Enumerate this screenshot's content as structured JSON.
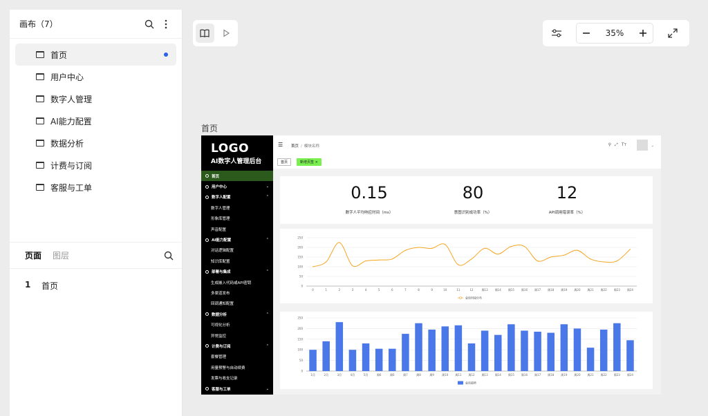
{
  "left_panel": {
    "title": "画布（7）",
    "canvases": [
      {
        "label": "首页",
        "active": true
      },
      {
        "label": "用户中心"
      },
      {
        "label": "数字人管理"
      },
      {
        "label": "AI能力配置"
      },
      {
        "label": "数据分析"
      },
      {
        "label": "计费与订阅"
      },
      {
        "label": "客服与工单"
      }
    ],
    "tabs": {
      "pages": "页面",
      "layers": "图层"
    },
    "pages": [
      {
        "num": "1",
        "label": "首页"
      }
    ]
  },
  "toolbar": {
    "zoom": "35%"
  },
  "canvas_label": "首页",
  "artboard": {
    "logo": "LOGO",
    "subtitle": "AI数字人管理后台",
    "nav": [
      {
        "label": "首页",
        "kind": "grp",
        "active": true
      },
      {
        "label": "用户中心",
        "kind": "grp",
        "chev": "⌄"
      },
      {
        "label": "数字人配置",
        "kind": "grp",
        "chev": "⌃"
      },
      {
        "label": "数字人管理",
        "kind": "sub"
      },
      {
        "label": "形象库管理",
        "kind": "sub"
      },
      {
        "label": "声音配置",
        "kind": "sub"
      },
      {
        "label": "AI能力配置",
        "kind": "grp",
        "chev": "⌃"
      },
      {
        "label": "对话逻辑配置",
        "kind": "sub"
      },
      {
        "label": "知识库配置",
        "kind": "sub"
      },
      {
        "label": "部署与集成",
        "kind": "grp",
        "chev": "⌃"
      },
      {
        "label": "生成嵌入代码或API密钥",
        "kind": "sub"
      },
      {
        "label": "多渠道发布",
        "kind": "sub"
      },
      {
        "label": "回调通知配置",
        "kind": "sub"
      },
      {
        "label": "数据分析",
        "kind": "grp",
        "chev": "⌃"
      },
      {
        "label": "可视化分析",
        "kind": "sub"
      },
      {
        "label": "异常监控",
        "kind": "sub"
      },
      {
        "label": "计费与订阅",
        "kind": "grp",
        "chev": "⌃"
      },
      {
        "label": "套餐管理",
        "kind": "sub"
      },
      {
        "label": "用量预警与自动续费",
        "kind": "sub"
      },
      {
        "label": "发票与收支记录",
        "kind": "sub"
      },
      {
        "label": "客服与工单",
        "kind": "grp",
        "chev": "⌄"
      }
    ],
    "breadcrumb": {
      "home": "首页",
      "sep": "/",
      "current": "模块名称"
    },
    "header_icons": [
      "search-icon",
      "fullscreen-icon",
      "font-size-icon"
    ],
    "tags": {
      "home": "首页",
      "active": "新增页签 ×"
    },
    "stats": [
      {
        "value": "0.15",
        "label": "数字人平均响应时间（ms）"
      },
      {
        "value": "80",
        "label": "意图识别成功率（%）"
      },
      {
        "value": "12",
        "label": "API调用错误率（%）"
      }
    ]
  },
  "chart_data": [
    {
      "type": "line",
      "title": "",
      "ylim": [
        0,
        250
      ],
      "y_ticks": [
        "0",
        "50",
        "100",
        "150",
        "200",
        "250"
      ],
      "categories": [
        "0",
        "1",
        "2",
        "3",
        "4",
        "5",
        "6",
        "7",
        "8",
        "9",
        "10",
        "11",
        "12",
        "周13",
        "周14",
        "周15",
        "周16",
        "周17",
        "周18",
        "周19",
        "周20",
        "周21",
        "周22",
        "周23",
        "周24"
      ],
      "series": [
        {
          "name": "会话时段分布",
          "color": "#f5a623",
          "values": [
            100,
            125,
            225,
            105,
            130,
            135,
            140,
            185,
            200,
            195,
            215,
            110,
            140,
            195,
            165,
            205,
            205,
            130,
            150,
            160,
            185,
            140,
            125,
            130,
            190
          ]
        }
      ]
    },
    {
      "type": "bar",
      "title": "",
      "ylim": [
        0,
        250
      ],
      "y_ticks": [
        "0",
        "50",
        "100",
        "150",
        "200",
        "250"
      ],
      "categories": [
        "1月",
        "2月",
        "3月",
        "4月",
        "5月",
        "周6",
        "周6",
        "周7",
        "周8",
        "周9",
        "周10",
        "周11",
        "周12",
        "周13",
        "周14",
        "周15",
        "周16",
        "周17",
        "周18",
        "周19",
        "周20",
        "周21",
        "周22",
        "周23",
        "周24"
      ],
      "series": [
        {
          "name": "会话趋势",
          "color": "#4a78e8",
          "values": [
            100,
            140,
            230,
            100,
            130,
            105,
            105,
            175,
            225,
            195,
            210,
            215,
            130,
            190,
            170,
            220,
            190,
            185,
            180,
            220,
            200,
            110,
            195,
            225,
            145
          ]
        }
      ]
    }
  ]
}
